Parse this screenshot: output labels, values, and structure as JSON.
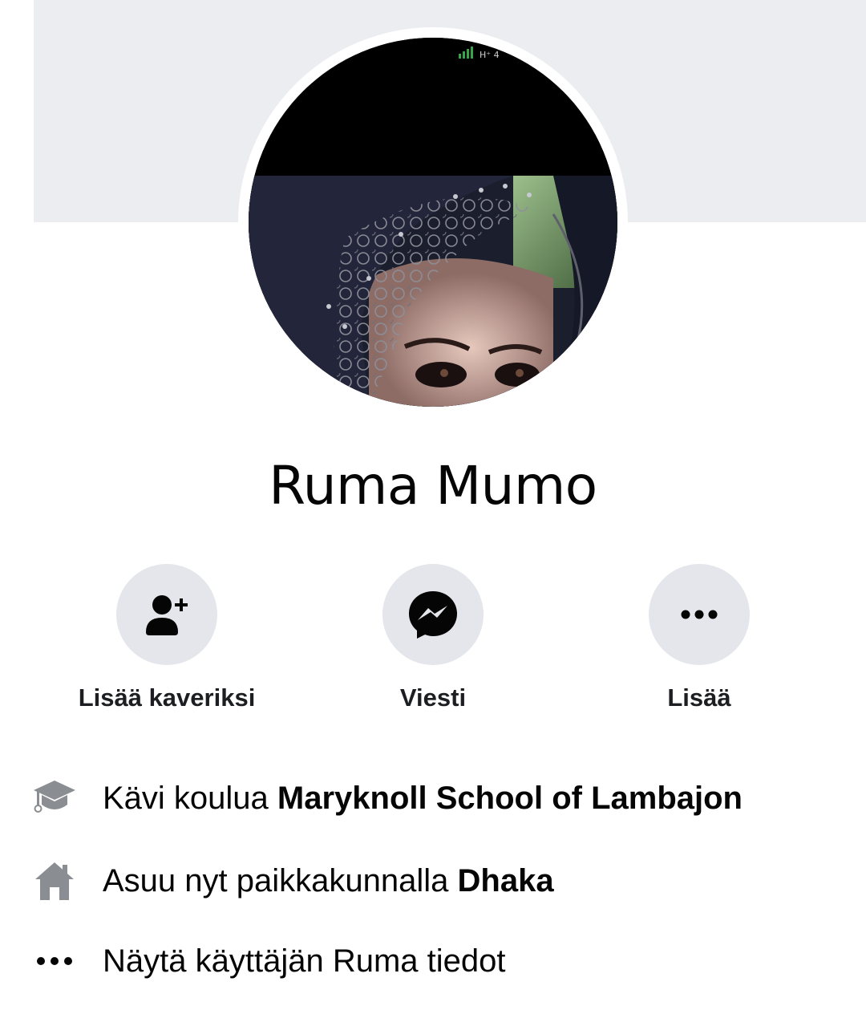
{
  "profile": {
    "name": "Ruma Mumo"
  },
  "actions": [
    {
      "label": "Lisää kaveriksi",
      "icon": "add-friend-icon"
    },
    {
      "label": "Viesti",
      "icon": "messenger-icon"
    },
    {
      "label": "Lisää",
      "icon": "more-icon"
    }
  ],
  "info": {
    "school": {
      "prefix": "Kävi koulua",
      "value": "Maryknoll School of Lambajon",
      "icon": "graduation-cap-icon"
    },
    "residence": {
      "prefix": "Asuu nyt paikkakunnalla",
      "value": "Dhaka",
      "icon": "home-icon"
    },
    "details": {
      "text": "Näytä käyttäjän Ruma tiedot",
      "icon": "more-dots-icon"
    }
  },
  "colors": {
    "cover": "#ebedf0",
    "button_bg": "#e4e6eb",
    "text": "#050505",
    "icon_gray": "#8a8d91"
  }
}
